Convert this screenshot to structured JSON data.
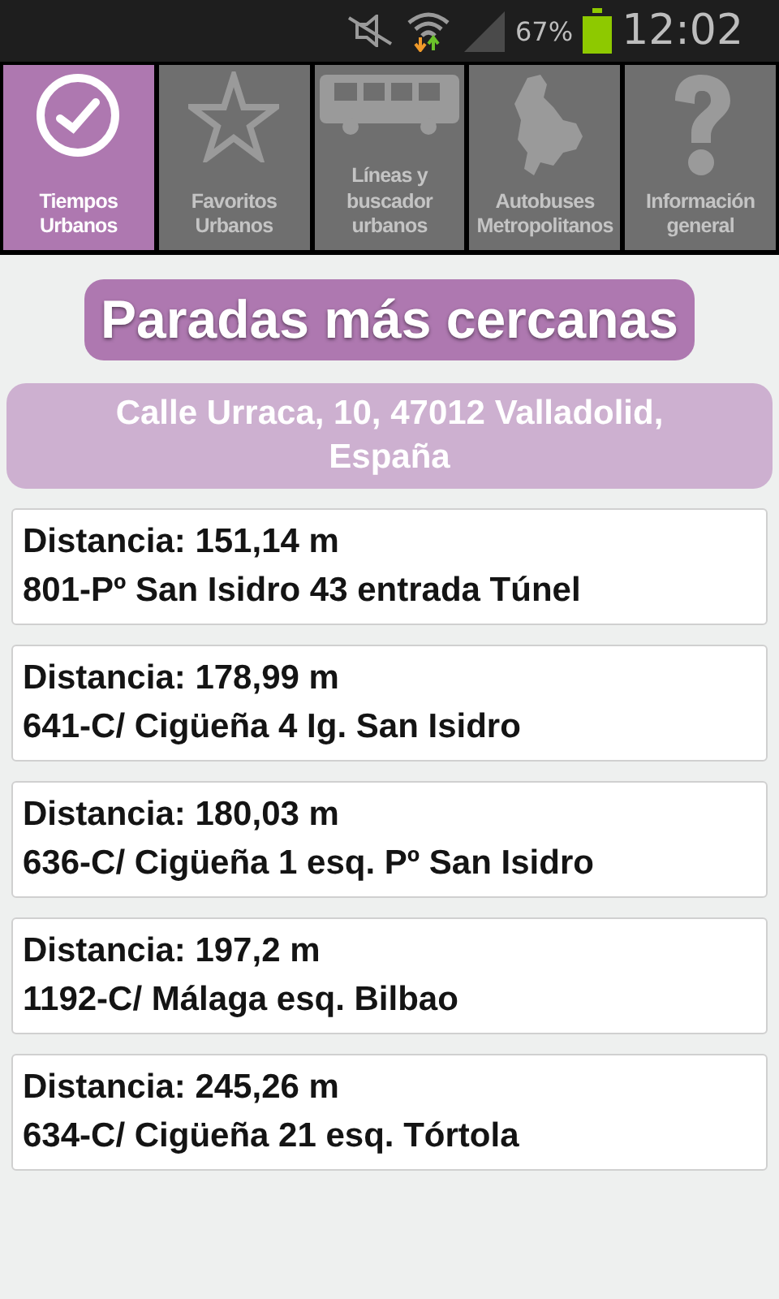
{
  "status_bar": {
    "battery": "67%",
    "time": "12:02"
  },
  "tabs": [
    {
      "kind": "check",
      "label": "Tiempos Urbanos",
      "selected": true
    },
    {
      "kind": "star",
      "label": "Favoritos Urbanos",
      "selected": false
    },
    {
      "kind": "bus",
      "label": "Líneas y buscador urbanos",
      "selected": false
    },
    {
      "kind": "map",
      "label": "Autobuses Metropolitanos",
      "selected": false
    },
    {
      "kind": "question",
      "label": "Información general",
      "selected": false
    }
  ],
  "title": "Paradas más cercanas",
  "address": "Calle Urraca, 10, 47012 Valladolid, España",
  "stops": [
    {
      "distance": "Distancia: 151,14 m",
      "name": "801-Pº San Isidro 43 entrada Túnel"
    },
    {
      "distance": "Distancia: 178,99 m",
      "name": "641-C/ Cigüeña 4 Ig. San Isidro"
    },
    {
      "distance": "Distancia: 180,03 m",
      "name": "636-C/ Cigüeña 1 esq. Pº San Isidro"
    },
    {
      "distance": "Distancia: 197,2 m",
      "name": "1192-C/ Málaga esq. Bilbao"
    },
    {
      "distance": "Distancia: 245,26 m",
      "name": "634-C/ Cigüeña 21 esq. Tórtola"
    }
  ]
}
